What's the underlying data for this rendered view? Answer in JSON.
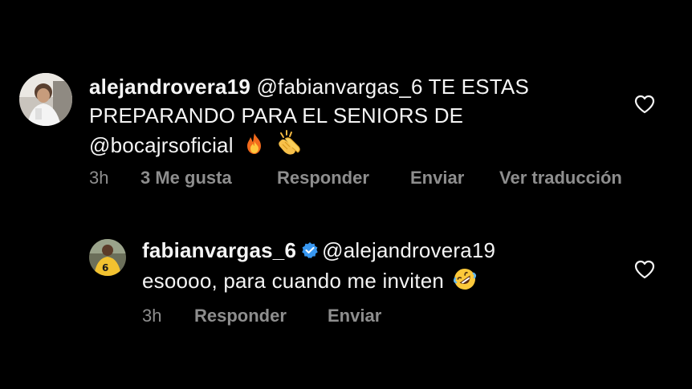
{
  "comments": [
    {
      "username": "alejandrovera19",
      "mention": "@fabianvargas_6",
      "text_line1": "TE ESTAS",
      "text_line2": "PREPARANDO PARA EL SENIORS DE",
      "mention2": "@bocajrsoficial",
      "emojis": [
        "fire-emoji",
        "clapping-hands-emoji"
      ],
      "time": "3h",
      "likes": "3 Me gusta",
      "reply": "Responder",
      "send": "Enviar",
      "translate": "Ver traducción",
      "liked": false
    }
  ],
  "replies": [
    {
      "username": "fabianvargas_6",
      "verified": true,
      "mention": "@alejandrovera19",
      "text": "esoooo, para cuando me inviten",
      "emoji": "rolling-on-floor-laughing-emoji",
      "time": "3h",
      "reply": "Responder",
      "send": "Enviar",
      "liked": false
    }
  ],
  "colors": {
    "background": "#000000",
    "text": "#f5f5f5",
    "secondary": "#8e8e8e",
    "verified": "#3897f0"
  }
}
